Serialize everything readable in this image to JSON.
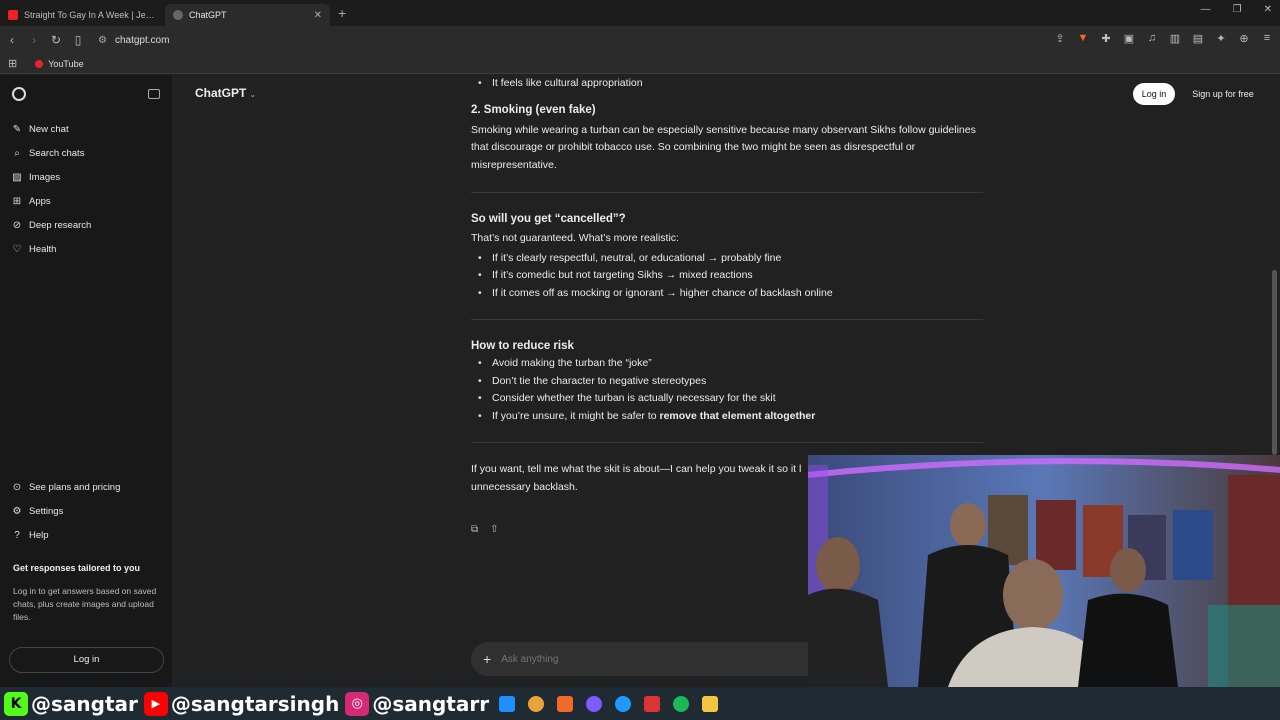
{
  "browser": {
    "tabs": [
      {
        "title": "Straight To Gay In A Week | Jerry Spr",
        "active": false
      },
      {
        "title": "ChatGPT",
        "active": true
      }
    ],
    "url": "chatgpt.com",
    "bookmarks": [
      {
        "label": "YouTube"
      }
    ]
  },
  "sidebar": {
    "items": [
      {
        "icon": "new-chat-icon",
        "label": "New chat"
      },
      {
        "icon": "search-icon",
        "label": "Search chats"
      },
      {
        "icon": "images-icon",
        "label": "Images"
      },
      {
        "icon": "apps-icon",
        "label": "Apps"
      },
      {
        "icon": "deep-research-icon",
        "label": "Deep research"
      },
      {
        "icon": "health-icon",
        "label": "Health"
      }
    ],
    "bottom_items": [
      {
        "icon": "plans-icon",
        "label": "See plans and pricing"
      },
      {
        "icon": "gear-icon",
        "label": "Settings"
      },
      {
        "icon": "help-icon",
        "label": "Help"
      }
    ],
    "promo": {
      "title": "Get responses tailored to you",
      "text": "Log in to get answers based on saved chats, plus create images and upload files."
    },
    "login_label": "Log in"
  },
  "header": {
    "model": "ChatGPT",
    "login": "Log in",
    "signup": "Sign up for free"
  },
  "chat": {
    "top_bullet": "It feels like cultural appropriation",
    "smoking": {
      "heading": "2. Smoking (even fake)",
      "para": "Smoking while wearing a turban can be especially sensitive because many observant Sikhs follow guidelines that discourage or prohibit tobacco use. So combining the two might be seen as disrespectful or misrepresentative."
    },
    "cancelled": {
      "heading": "So will you get “cancelled”?",
      "intro": "That’s not guaranteed. What’s more realistic:",
      "bullets": [
        "If it’s clearly respectful, neutral, or educational → probably fine",
        "If it’s comedic but not targeting Sikhs → mixed reactions",
        "If it comes off as mocking or ignorant → higher chance of backlash online"
      ]
    },
    "reduce": {
      "heading": "How to reduce risk",
      "bullets": [
        "Avoid making the turban the “joke”",
        "Don’t tie the character to negative stereotypes",
        "Consider whether the turban is actually necessary for the skit"
      ],
      "last_prefix": "If you’re unsure, it might be safer to ",
      "last_bold": "remove that element altogether"
    },
    "closing_line1": "If you want, tell me what the skit is about—I can help you tweak it so it l",
    "closing_line2": "unnecessary backlash."
  },
  "composer": {
    "placeholder": "Ask anything"
  },
  "overlay": {
    "kick": "@sangtar",
    "youtube": "@sangtarsingh",
    "instagram": "@sangtarr"
  },
  "colors": {
    "kick": "#53fc18",
    "youtube": "#ff0000",
    "instagram": "#d62976",
    "accent": "#ececec"
  }
}
